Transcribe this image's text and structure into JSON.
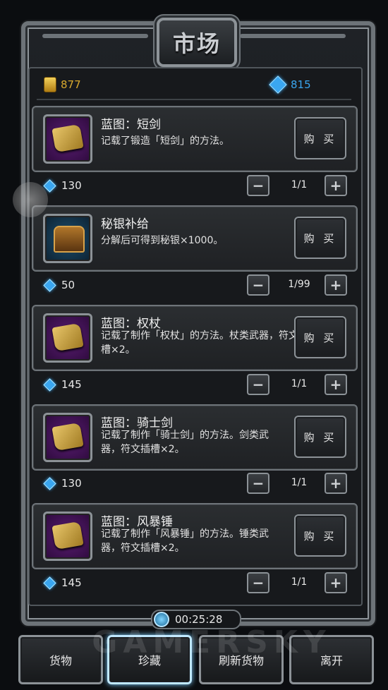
{
  "title": "市场",
  "currency": {
    "gold": "877",
    "gems": "815"
  },
  "items": [
    {
      "name": "蓝图：短剑",
      "desc": "记载了锻造「短剑」的方法。",
      "buy": "购 买",
      "price": "130",
      "qty": "1/1",
      "icon": "blueprint-scroll-icon"
    },
    {
      "name": "秘银补给",
      "desc": "分解后可得到秘银×1000。",
      "buy": "购 买",
      "price": "50",
      "qty": "1/99",
      "icon": "treasure-chest-icon"
    },
    {
      "name": "蓝图：权杖",
      "desc": "记载了制作「权杖」的方法。杖类武器，符文插槽×2。",
      "buy": "购 买",
      "price": "145",
      "qty": "1/1",
      "icon": "blueprint-scroll-icon"
    },
    {
      "name": "蓝图：骑士剑",
      "desc": "记载了制作「骑士剑」的方法。剑类武器，符文插槽×2。",
      "buy": "购 买",
      "price": "130",
      "qty": "1/1",
      "icon": "blueprint-scroll-icon"
    },
    {
      "name": "蓝图：风暴锤",
      "desc": "记载了制作「风暴锤」的方法。锤类武器，符文插槽×2。",
      "buy": "购 买",
      "price": "145",
      "qty": "1/1",
      "icon": "blueprint-scroll-icon"
    }
  ],
  "timer": "00:25:28",
  "bottom_tabs": [
    "货物",
    "珍藏",
    "刷新货物",
    "离开"
  ],
  "watermark": "GAMERSKY",
  "colors": {
    "gold": "#d9a92e",
    "gem": "#3aa6f0",
    "active_border": "#bfe8ff"
  }
}
